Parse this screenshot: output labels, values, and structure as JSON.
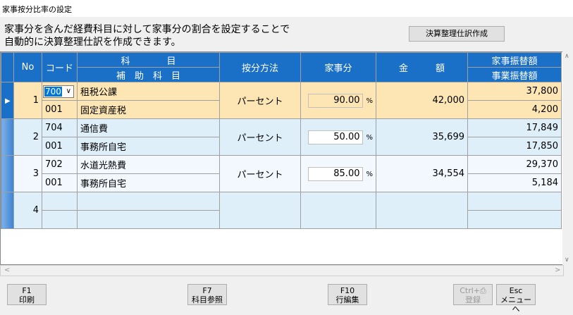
{
  "window": {
    "title": "家事按分比率の設定"
  },
  "description": {
    "line1": "家事分を含んだ経費科目に対して家事分の割合を設定することで",
    "line2": "自動的に決算整理仕訳を作成できます。"
  },
  "top_button": {
    "label": "決算整理仕訳作成"
  },
  "grid": {
    "headers": {
      "no": "No",
      "code": "コード",
      "account": "科　　　　目",
      "subaccount": "補　助　科　目",
      "method": "按分方法",
      "household": "家事分",
      "amount": "金　　　額",
      "household_transfer": "家事振替額",
      "business_transfer": "事業振替額"
    },
    "rows": [
      {
        "no": "1",
        "code": "700",
        "account": "租税公課",
        "sub_code": "001",
        "subaccount": "固定資産税",
        "method": "パーセント",
        "pct": "90.00",
        "pct_unit": "%",
        "amount": "42,000",
        "household": "37,800",
        "business": "4,200"
      },
      {
        "no": "2",
        "code": "704",
        "account": "通信費",
        "sub_code": "001",
        "subaccount": "事務所自宅",
        "method": "パーセント",
        "pct": "50.00",
        "pct_unit": "%",
        "amount": "35,699",
        "household": "17,849",
        "business": "17,850"
      },
      {
        "no": "3",
        "code": "702",
        "account": "水道光熱費",
        "sub_code": "001",
        "subaccount": "事務所自宅",
        "method": "パーセント",
        "pct": "85.00",
        "pct_unit": "%",
        "amount": "34,554",
        "household": "29,370",
        "business": "5,184"
      },
      {
        "no": "4"
      }
    ]
  },
  "footer": {
    "f1": {
      "key": "F1",
      "label": "印刷"
    },
    "f7": {
      "key": "F7",
      "label": "科目参照"
    },
    "f10": {
      "key": "F10",
      "label": "行編集"
    },
    "ctrl": {
      "key": "Ctrl+⎙",
      "label": "登録"
    },
    "esc": {
      "key": "Esc",
      "label": "メニューへ"
    }
  }
}
